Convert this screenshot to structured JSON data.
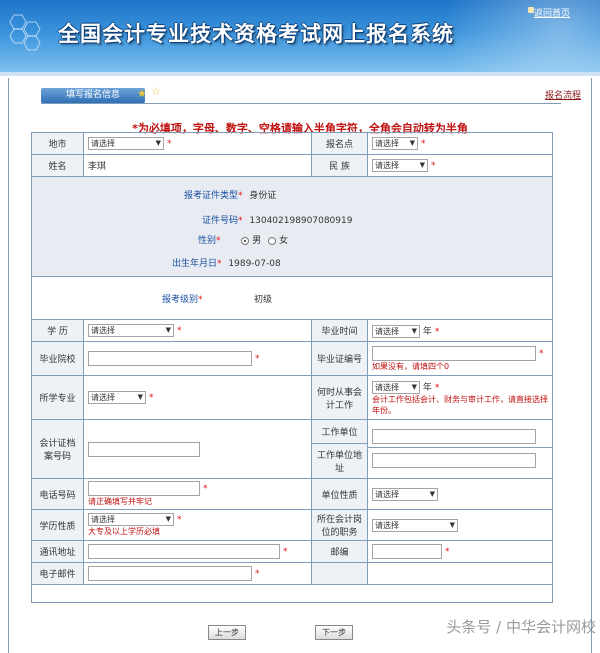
{
  "banner": {
    "title": "全国会计专业技术资格考试网上报名系统",
    "home_link": "返回首页"
  },
  "tabs": {
    "active": "填写报名信息",
    "process_link": "报名流程"
  },
  "notice": "*为必填项，字母、数字、空格请输入半角字符，全角会自动转为半角",
  "form": {
    "region_label": "地市",
    "region_value": "请选择",
    "site_label": "报名点",
    "site_value": "请选择",
    "name_label": "姓名",
    "name_value": "李琪",
    "ethnic_label": "民 族",
    "ethnic_value": "请选择",
    "id_type_label": "报考证件类型",
    "id_type_value": "身份证",
    "id_no_label": "证件号码",
    "id_no_value": "130402198907080919",
    "gender_label": "性别",
    "gender_male": "男",
    "gender_female": "女",
    "birth_label": "出生年月日",
    "birth_value": "1989-07-08",
    "level_label": "报考级别",
    "level_value": "初级",
    "edu_label": "学 历",
    "edu_value": "请选择",
    "grad_time_label": "毕业时间",
    "grad_time_value": "请选择",
    "year_unit": "年",
    "school_label": "毕业院校",
    "cert_no_label": "毕业证编号",
    "cert_no_hint": "如果没有，请填四个0",
    "major_label": "所学专业",
    "major_value": "请选择",
    "work_since_label": "何时从事会计工作",
    "work_since_value": "请选择",
    "work_since_hint": "会计工作包括会计、财务与审计工作，请直接选择年份。",
    "archive_label": "会计证档案号码",
    "employer_label": "工作单位",
    "employer_addr_label": "工作单位地址",
    "phone_label": "电话号码",
    "phone_hint": "请正确填写并牢记",
    "employer_type_label": "单位性质",
    "employer_type_value": "请选择",
    "edu_type_label": "学历性质",
    "edu_type_value": "请选择",
    "edu_type_hint": "大专及以上学历必填",
    "position_label": "所在会计岗位的职务",
    "position_value": "请选择",
    "address_label": "通讯地址",
    "zip_label": "邮编",
    "email_label": "电子邮件",
    "req_mark": "*"
  },
  "buttons": {
    "prev": "上一步",
    "next": "下一步"
  },
  "watermark": "头条号 / 中华会计网校"
}
